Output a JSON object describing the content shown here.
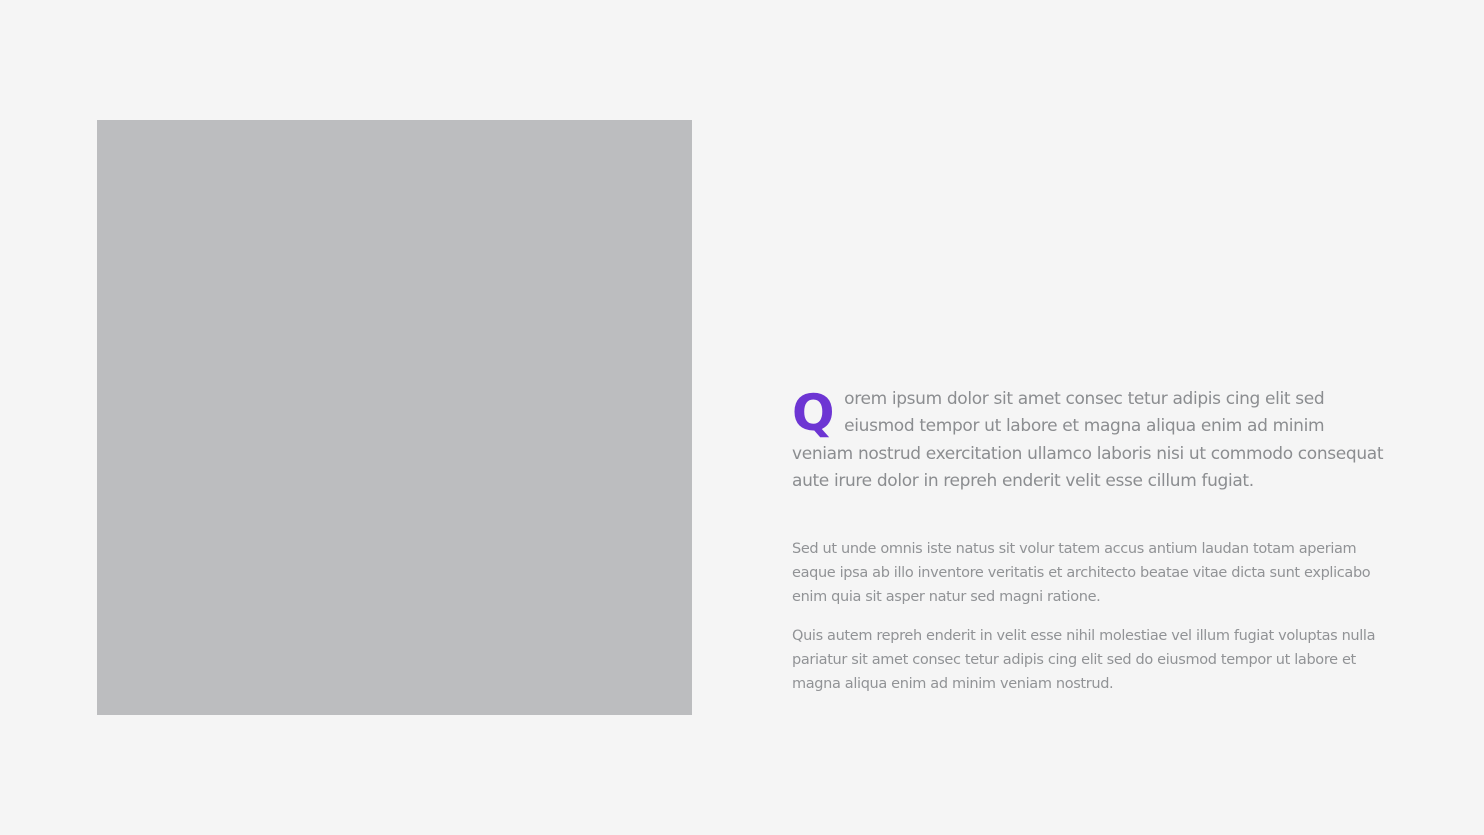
{
  "lead": {
    "dropcap": "Q",
    "text": "orem ipsum dolor sit amet consec tetur adipis cing elit sed eiusmod tempor ut labore et magna aliqua enim ad minim veniam nostrud exercitation ullamco laboris nisi ut commodo consequat aute irure dolor in repreh enderit velit esse cillum fugiat."
  },
  "paragraphs": [
    "Sed ut unde omnis iste natus sit volur tatem accus antium laudan totam aperiam eaque ipsa ab illo inventore veritatis et architecto beatae vitae dicta sunt explicabo enim quia sit asper natur sed magni ratione.",
    "Quis autem repreh enderit in velit esse nihil molestiae vel illum fugiat voluptas nulla pariatur sit amet consec tetur adipis cing elit sed do eiusmod tempor ut labore et magna aliqua enim ad minim veniam nostrud."
  ],
  "colors": {
    "background": "#f5f5f5",
    "placeholder": "#bcbdbf",
    "accent": "#6d35d3",
    "text": "#8b8d90"
  }
}
